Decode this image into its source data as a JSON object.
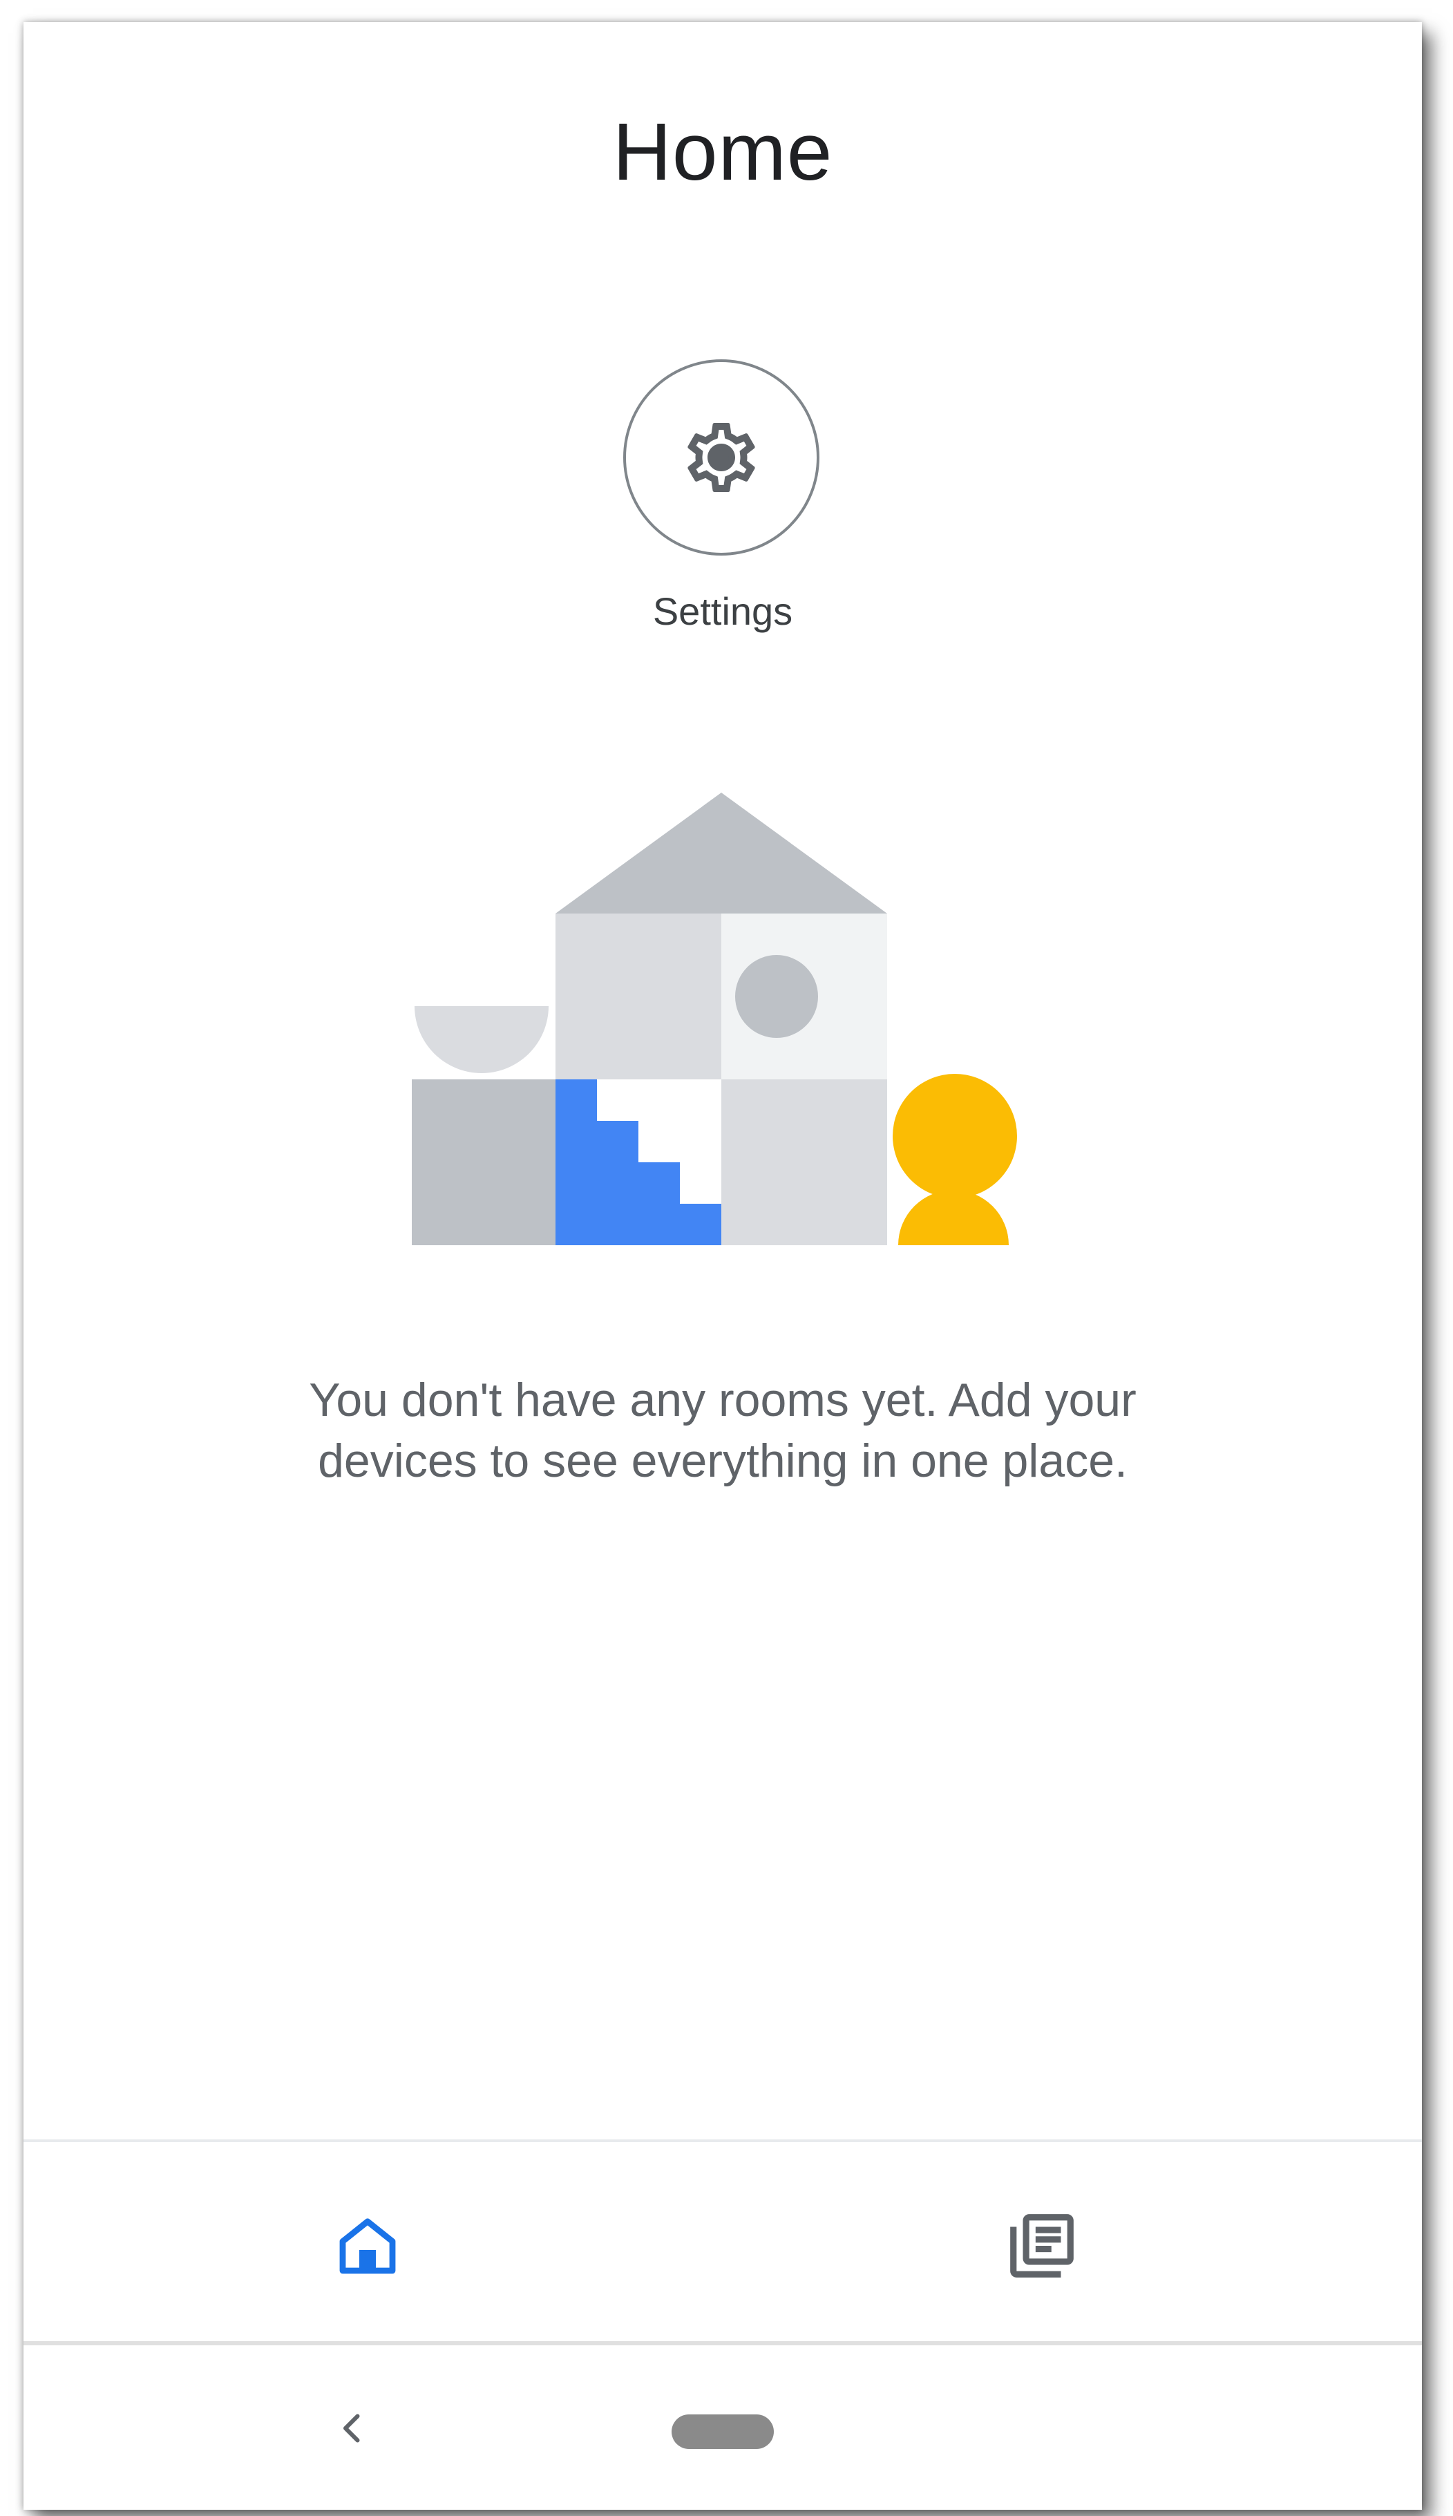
{
  "header": {
    "title": "Home"
  },
  "quick_actions": {
    "settings_label": "Settings",
    "settings_icon": "gear-icon"
  },
  "empty_state": {
    "line1": "You don't have any rooms yet. Add your",
    "line2": "devices to see everything in one place."
  },
  "bottom_nav": {
    "items": [
      {
        "icon": "home-icon",
        "active": true
      },
      {
        "icon": "feed-icon",
        "active": false
      }
    ]
  },
  "system_nav": {
    "back_icon": "back-chevron-icon",
    "home_icon": "home-pill"
  },
  "colors": {
    "accent": "#1a73e8",
    "illustration_blue": "#4285f4",
    "illustration_yellow": "#fbbc04",
    "illustration_gray_dark": "#bdc1c6",
    "illustration_gray_light": "#dadce0",
    "illustration_gray_lighter": "#f1f3f4"
  }
}
